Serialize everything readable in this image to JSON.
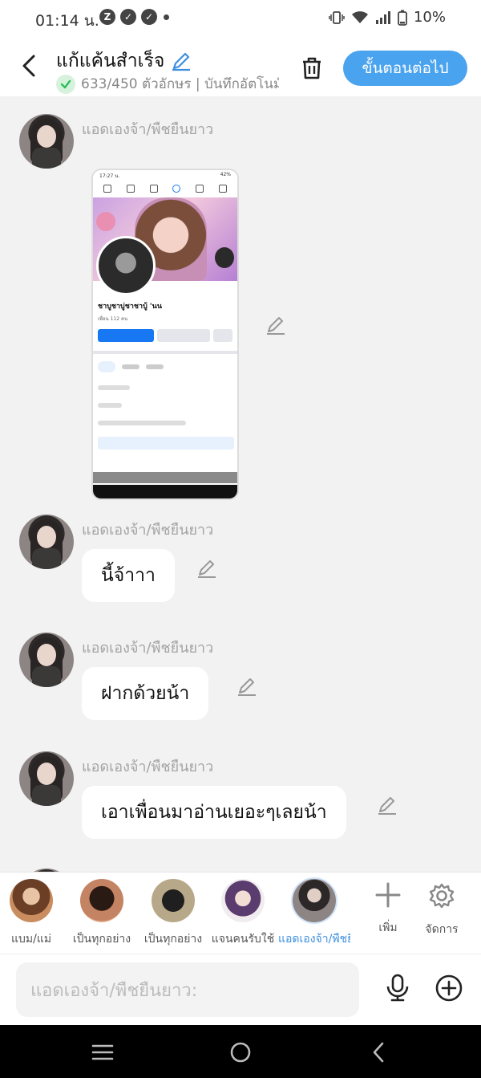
{
  "status_bar": {
    "time": "01:14 น.",
    "battery": "10%"
  },
  "header": {
    "title": "แก้แค้นสำเร็จ",
    "subtitle": "633/450 ตัวอักษร | บันทึกอัตโนมัติ",
    "next_label": "ขั้นตอนต่อไป"
  },
  "messages": [
    {
      "sender": "แอดเองจ้า/พืชยืนยาว",
      "type": "image"
    },
    {
      "sender": "แอดเองจ้า/พืชยืนยาว",
      "type": "text",
      "text": "นี้จ้าาา"
    },
    {
      "sender": "แอดเองจ้า/พืชยืนยาว",
      "type": "text",
      "text": "ฝากด้วยน้า"
    },
    {
      "sender": "แอดเองจ้า/พืชยืนยาว",
      "type": "text",
      "text": "เอาเพื่อนมาอ่านเยอะๆเลยน้า"
    }
  ],
  "screenshot": {
    "time": "17:27 น.",
    "battery": "42%",
    "profile_name": "ชาบูชาบู่ชาชาบู้ 'นน",
    "friends_count": "เพื่อน 112 คน"
  },
  "characters": [
    {
      "name": "แบม/แม่"
    },
    {
      "name": "เป็นทุกอย่าง"
    },
    {
      "name": "เป็นทุกอย่าง"
    },
    {
      "name": "แจนคนรับใช้"
    },
    {
      "name": "แอดเองจ้า/พืชยืนยาว"
    }
  ],
  "tools": {
    "add_label": "เพิ่ม",
    "manage_label": "จัดการ"
  },
  "input": {
    "placeholder": "แอดเองจ้า/พืชยืนยาว:"
  }
}
